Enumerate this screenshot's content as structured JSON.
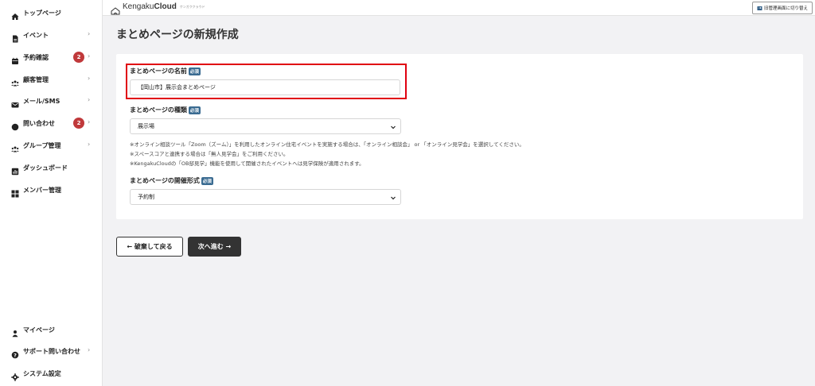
{
  "sidebar": {
    "items": [
      {
        "label": "トップページ",
        "icon": "home-icon"
      },
      {
        "label": "イベント",
        "icon": "document-icon",
        "chevron": "›"
      },
      {
        "label": "予約確認",
        "icon": "calendar-icon",
        "badge": "2",
        "chevron": "›"
      },
      {
        "label": "顧客管理",
        "icon": "users-icon",
        "chevron": "›"
      },
      {
        "label": "メール/SMS",
        "icon": "mail-icon",
        "chevron": "›"
      },
      {
        "label": "問い合わせ",
        "icon": "chat-icon",
        "badge": "2",
        "chevron": "›"
      },
      {
        "label": "グループ管理",
        "icon": "group-icon",
        "chevron": "›"
      },
      {
        "label": "ダッシュボード",
        "icon": "chart-icon"
      },
      {
        "label": "メンバー管理",
        "icon": "grid-icon"
      }
    ],
    "bottom_items": [
      {
        "label": "マイページ",
        "icon": "user-icon"
      },
      {
        "label": "サポート問い合わせ",
        "icon": "question-icon",
        "chevron": "›"
      },
      {
        "label": "システム設定",
        "icon": "gear-icon"
      }
    ]
  },
  "topbar": {
    "logo_regular": "Kengaku",
    "logo_bold": "Cloud",
    "logo_sub": "ケンガククラウド",
    "switch_label": "旧管理画面に切り替え"
  },
  "page": {
    "title": "まとめページの新規作成"
  },
  "form": {
    "required_label": "必須",
    "name_label": "まとめページの名前",
    "name_value": "【岡山市】展示会まとめページ",
    "type_label": "まとめページの種類",
    "type_value": "展示場",
    "notes": [
      "※オンライン相談ツール「Zoom（ズーム）」を利用したオンライン住宅イベントを実施する場合は、「オンライン相談会」 or 「オンライン見学会」を選択してください。",
      "※スペースコアと連携する場合は「無人見学会」をご利用ください。",
      "※KengakuCloudの「OB邸見学」機能を使用して開催されたイベントへは見学保険が適用されます。"
    ],
    "format_label": "まとめページの開催形式",
    "format_value": "予約制"
  },
  "actions": {
    "back_label": "← 破棄して戻る",
    "next_label": "次へ進む →"
  },
  "colors": {
    "highlight": "#e00010",
    "badge": "#c0393b",
    "required_tag": "#3a6b91",
    "primary_button": "#333333"
  }
}
